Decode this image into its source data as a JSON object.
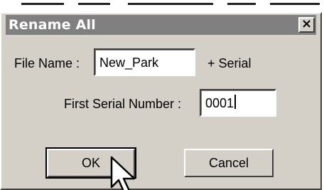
{
  "dialog": {
    "title": "Rename All",
    "close_glyph": "×"
  },
  "form": {
    "file_name_label": "File Name :",
    "file_name_value": "New_Park",
    "serial_suffix_label": "+ Serial",
    "first_serial_label": "First Serial Number :",
    "first_serial_value": "0001"
  },
  "buttons": {
    "ok_label": "OK",
    "cancel_label": "Cancel"
  },
  "icons": {
    "close": "close-icon",
    "cursor": "mouse-pointer-icon"
  }
}
